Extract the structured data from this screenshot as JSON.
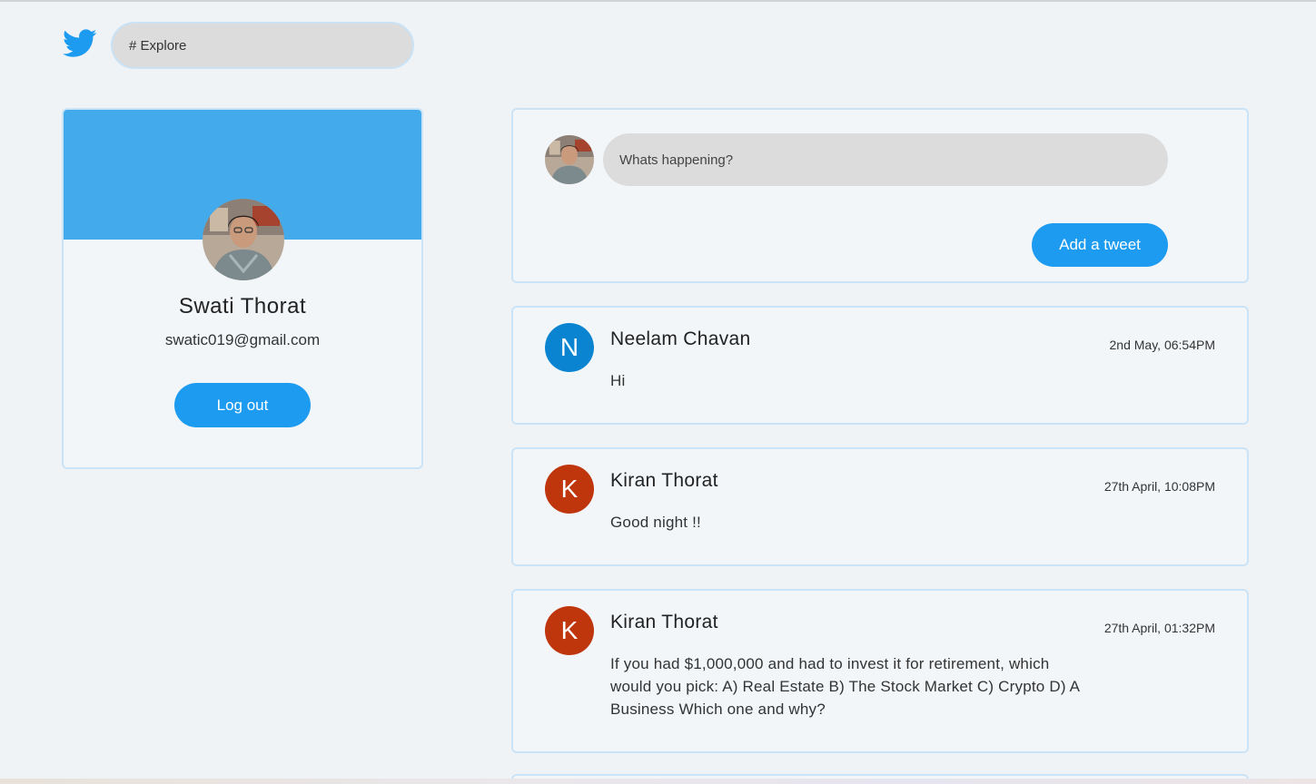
{
  "header": {
    "logo_icon": "twitter-bird-icon",
    "explore_placeholder": "# Explore"
  },
  "profile": {
    "name": "Swati Thorat",
    "email": "swatic019@gmail.com",
    "logout_label": "Log out",
    "banner_color": "#43abec"
  },
  "compose": {
    "placeholder": "Whats happening?",
    "submit_label": "Add a tweet"
  },
  "tweets": [
    {
      "initial": "N",
      "author": "Neelam Chavan",
      "time": "2nd May, 06:54PM",
      "text": "Hi",
      "avatar_color": "#0a84d0"
    },
    {
      "initial": "K",
      "author": "Kiran Thorat",
      "time": "27th April, 10:08PM",
      "text": "Good night !!",
      "avatar_color": "#c0360c"
    },
    {
      "initial": "K",
      "author": "Kiran Thorat",
      "time": "27th April, 01:32PM",
      "text": "If you had $1,000,000 and had to invest it for retirement, which would you pick: A) Real Estate B) The Stock Market C) Crypto D) A Business Which one and why?",
      "avatar_color": "#c0360c"
    }
  ],
  "colors": {
    "accent": "#1d9bf0",
    "page_background": "#eff3f6"
  }
}
